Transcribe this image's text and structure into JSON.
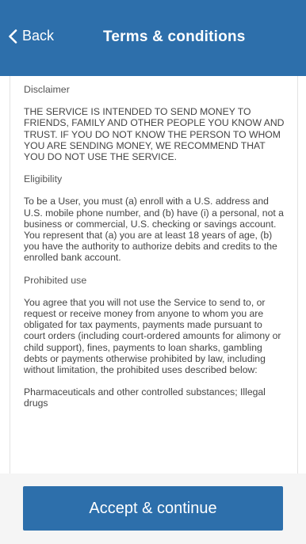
{
  "header": {
    "back_label": "Back",
    "title": "Terms & conditions"
  },
  "terms": {
    "sections": [
      {
        "heading": "Disclaimer",
        "body": "THE SERVICE IS INTENDED TO SEND MONEY TO FRIENDS, FAMILY AND OTHER PEOPLE YOU KNOW AND TRUST. IF YOU DO NOT KNOW THE PERSON TO WHOM YOU ARE SENDING MONEY, WE RECOMMEND THAT YOU DO NOT USE THE SERVICE."
      },
      {
        "heading": "Eligibility",
        "body": "To be a User, you must (a) enroll with a U.S. address and U.S. mobile phone number, and (b) have (i) a personal, not a business or commercial, U.S. checking or savings account. You represent that (a) you are at least 18 years of age, (b) you have the authority to authorize debits and credits to the enrolled bank account."
      },
      {
        "heading": "Prohibited use",
        "body": "You agree that you will not use the Service to send to, or request or receive money from anyone to whom you are obligated for tax payments, payments made pursuant to court orders (including court-ordered amounts for alimony or child support), fines, payments to loan sharks, gambling debts or payments otherwise prohibited by law, including without limitation, the prohibited uses described below:"
      }
    ],
    "trailing_text": "Pharmaceuticals and other controlled substances; Illegal drugs"
  },
  "footer": {
    "accept_label": "Accept & continue"
  },
  "colors": {
    "brand_blue": "#2d6fab",
    "text_gray": "#444444"
  },
  "icons": {
    "back": "chevron-left-icon"
  }
}
